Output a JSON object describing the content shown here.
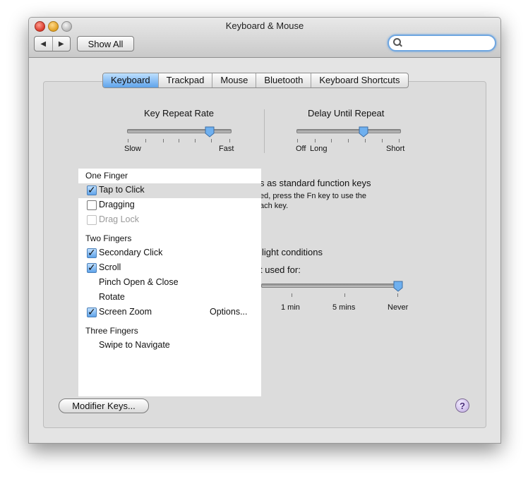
{
  "window": {
    "title": "Keyboard & Mouse",
    "nav_back": "◀",
    "nav_forward": "▶",
    "show_all": "Show All",
    "search_placeholder": ""
  },
  "tabs": [
    "Keyboard",
    "Trackpad",
    "Mouse",
    "Bluetooth",
    "Keyboard Shortcuts"
  ],
  "active_tab": "Keyboard",
  "key_repeat": {
    "label": "Key Repeat Rate",
    "min_label": "Slow",
    "max_label": "Fast",
    "value_fraction": 0.8
  },
  "delay_repeat": {
    "label": "Delay Until Repeat",
    "off_label": "Off",
    "min_label": "Long",
    "max_label": "Short",
    "value_fraction": 0.65
  },
  "partial_text": {
    "fn_keys": "s as standard function keys",
    "fn_line2": "ed, press the Fn key to use the",
    "fn_line3": "ach key.",
    "light": "light conditions",
    "used_for": "t used for:"
  },
  "backlight_slider": {
    "ticks": [
      "1 min",
      "5 mins",
      "Never"
    ],
    "value": "Never"
  },
  "modifier_button": "Modifier Keys...",
  "help": "?",
  "overlay": {
    "one_finger": "One Finger",
    "tap_to_click": "Tap to Click",
    "dragging": "Dragging",
    "drag_lock": "Drag Lock",
    "two_fingers": "Two Fingers",
    "secondary_click": "Secondary Click",
    "scroll": "Scroll",
    "pinch": "Pinch Open & Close",
    "rotate": "Rotate",
    "screen_zoom": "Screen Zoom",
    "options": "Options...",
    "three_fingers": "Three Fingers",
    "swipe": "Swipe to Navigate"
  }
}
